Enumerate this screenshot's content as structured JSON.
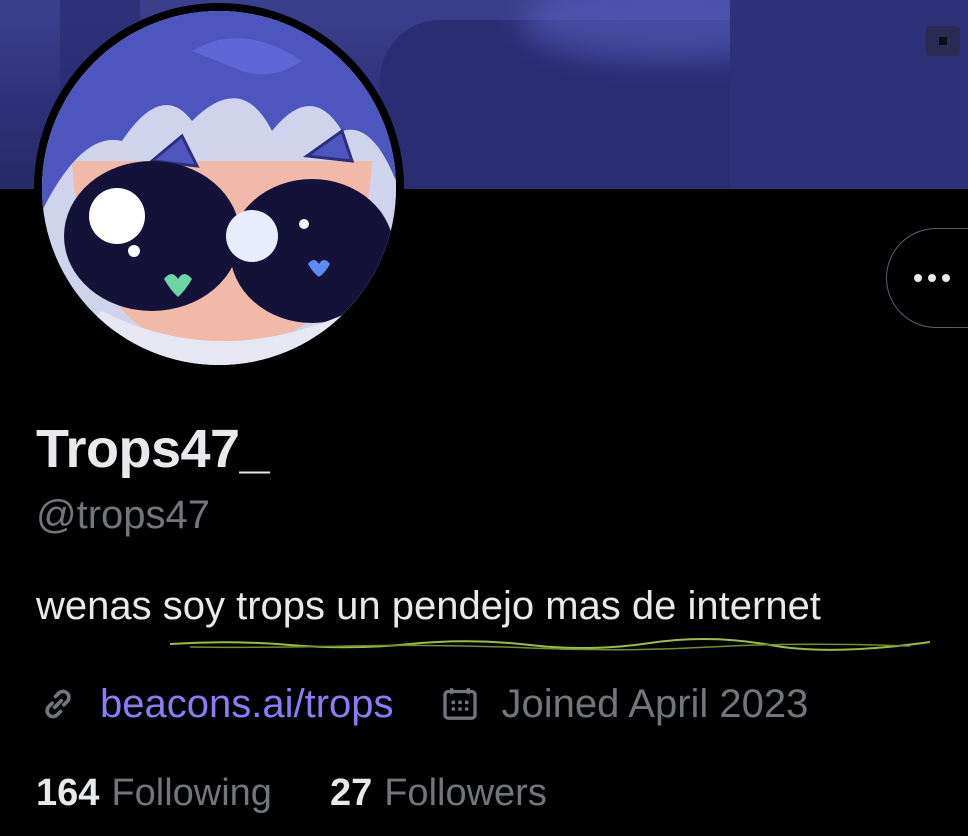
{
  "profile": {
    "display_name": "Trops47_",
    "handle": "@trops47",
    "bio": "wenas soy trops un pendejo mas de internet",
    "website": "beacons.ai/trops",
    "joined": "Joined April 2023"
  },
  "stats": {
    "following_count": "164",
    "following_label": "Following",
    "followers_count": "27",
    "followers_label": "Followers"
  },
  "icons": {
    "link": "link-icon",
    "calendar": "calendar-icon",
    "more": "more-options-icon"
  },
  "colors": {
    "background": "#000000",
    "text_primary": "#e7e9ea",
    "text_secondary": "#71767b",
    "link": "#8b7cf5",
    "banner": "#2f3178"
  }
}
